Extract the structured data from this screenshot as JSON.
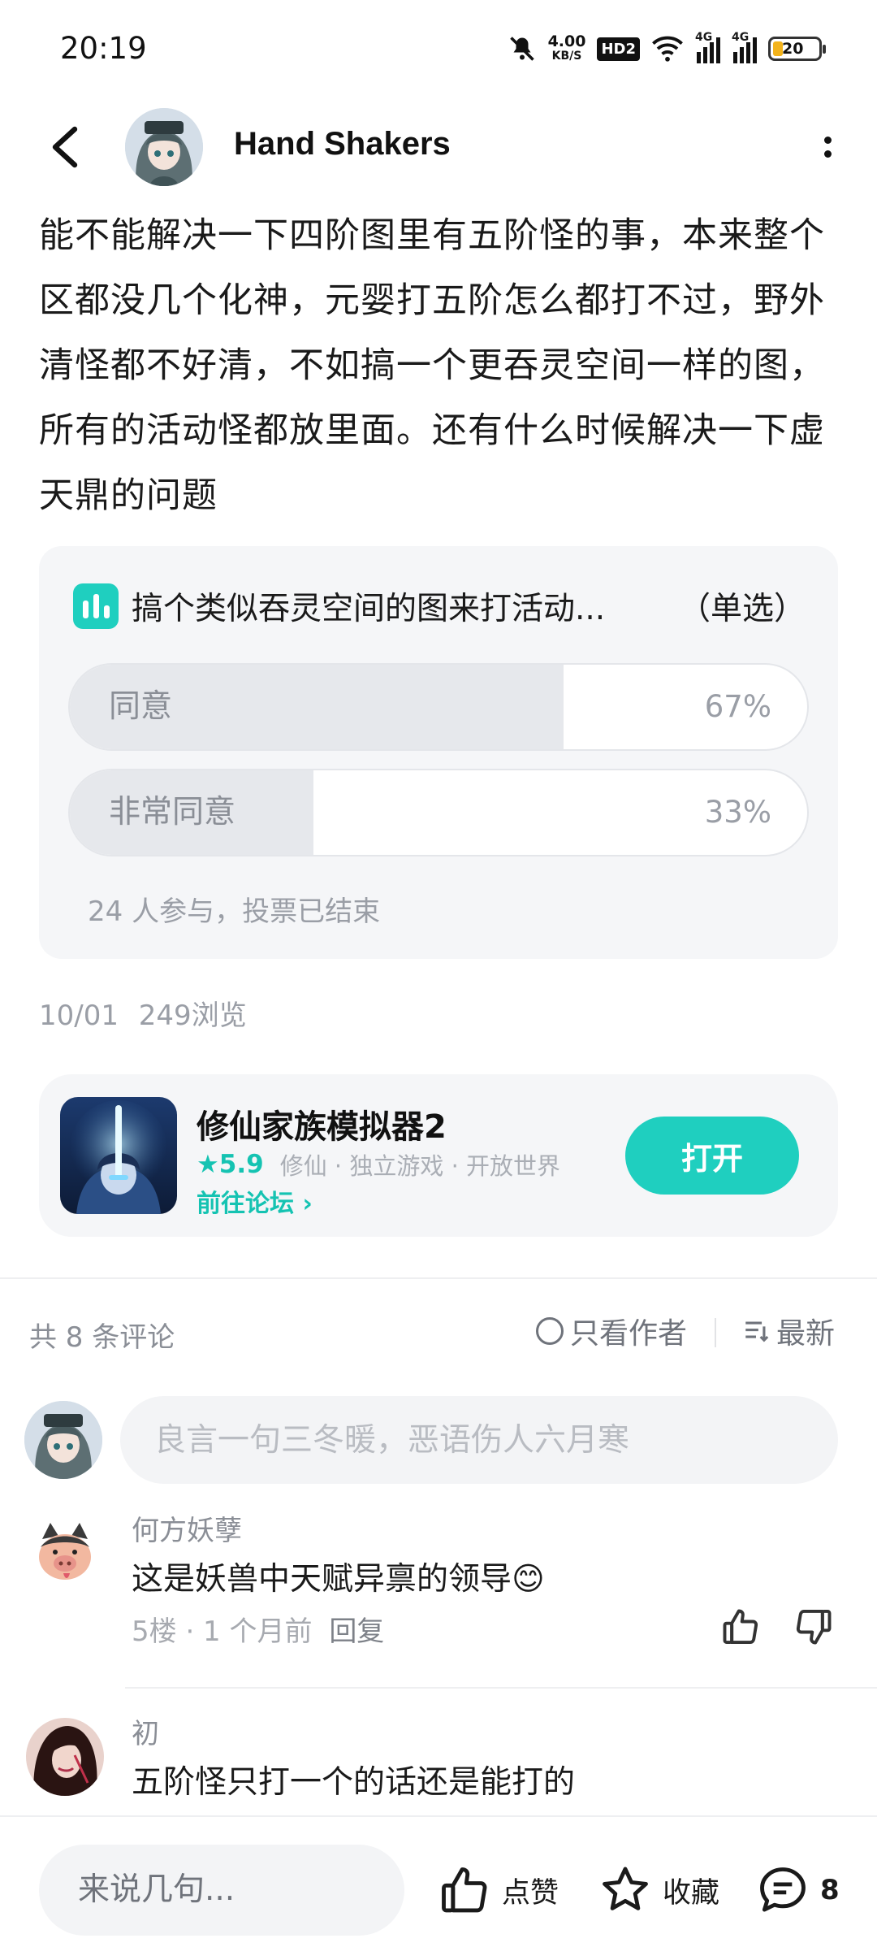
{
  "status_bar": {
    "time": "20:19",
    "net_speed_value": "4.00",
    "net_speed_unit": "KB/S",
    "hd_badge": "HD2",
    "network_1": "4G",
    "network_2": "4G",
    "battery": "20",
    "icons": [
      "mute-icon",
      "wifi-icon",
      "signal-icon",
      "signal-icon",
      "battery-icon"
    ]
  },
  "header": {
    "title": "Hand  Shakers",
    "icons": [
      "back-arrow-icon",
      "more-vertical-icon"
    ]
  },
  "post": {
    "body": "能不能解决一下四阶图里有五阶怪的事，本来整个区都没几个化神，元婴打五阶怎么都打不过，野外清怪都不好清，不如搞一个更吞灵空间一样的图，所有的活动怪都放里面。还有什么时候解决一下虚天鼎的问题",
    "date": "10/01",
    "views": "249浏览"
  },
  "vote": {
    "title": "搞个类似吞灵空间的图来打活动...",
    "type": "（单选）",
    "options": [
      {
        "label": "同意",
        "percent_text": "67%",
        "percent": 67
      },
      {
        "label": "非常同意",
        "percent_text": "33%",
        "percent": 33
      }
    ],
    "footer": "24 人参与，投票已结束",
    "accent": "#1fcfbf"
  },
  "game": {
    "name": "修仙家族模拟器2",
    "rating": "★5.9",
    "tags": "修仙 · 独立游戏 · 开放世界",
    "forum_link": "前往论坛 ›",
    "open_button": "打开",
    "accent": "#1fcfbf"
  },
  "comments_header": {
    "count": "共 8 条评论",
    "author_only": "只看作者",
    "sort": "最新"
  },
  "comment_input": {
    "placeholder": "良言一句三冬暖，恶语伤人六月寒"
  },
  "comments": [
    {
      "name": "何方妖孽",
      "text": "这是妖兽中天赋异禀的领导😊",
      "meta": "5楼 · 1 个月前",
      "reply": "回复"
    },
    {
      "name": "初",
      "text": "五阶怪只打一个的话还是能打的"
    }
  ],
  "bottom_bar": {
    "input_placeholder": "来说几句...",
    "like_label": "点赞",
    "fav_label": "收藏",
    "comment_count": "8"
  }
}
